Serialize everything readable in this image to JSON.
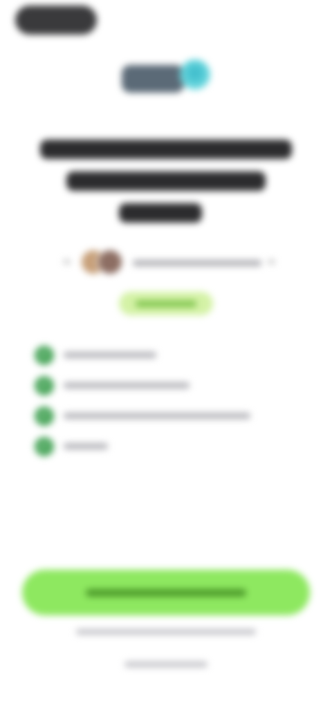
{
  "top_bar": {
    "left_button_label": "",
    "right_link_label": ""
  },
  "header": {
    "logo_name": "app-logo",
    "headline": ""
  },
  "social_proof": {
    "rating_text": "",
    "badge_label": ""
  },
  "features": [
    {
      "icon": "check-icon",
      "label": ""
    },
    {
      "icon": "check-icon",
      "label": ""
    },
    {
      "icon": "check-icon",
      "label": ""
    },
    {
      "icon": "check-icon",
      "label": ""
    }
  ],
  "cta": {
    "button_label": "",
    "footnote": "",
    "secondary_link": ""
  },
  "colors": {
    "accent_green": "#8ee860",
    "check_green": "#49a55a",
    "badge_bg": "#d4f2a6",
    "logo_teal": "#38b7c8",
    "logo_slate": "#5b6a77",
    "top_pill": "#3a3a3c"
  }
}
